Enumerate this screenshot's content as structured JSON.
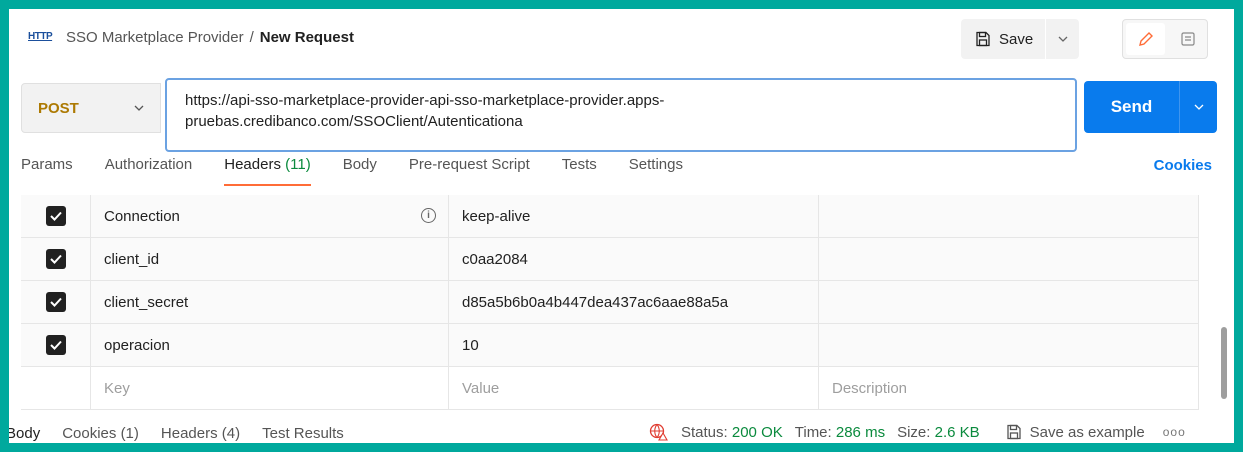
{
  "header": {
    "icon_label": "HTTP",
    "breadcrumb_parent": "SSO Marketplace Provider",
    "separator": "/",
    "breadcrumb_current": "New Request",
    "save_label": "Save"
  },
  "request": {
    "method": "POST",
    "url_line1": "https://api-sso-marketplace-provider-api-sso-marketplace-provider.apps-",
    "url_line2": "pruebas.credibanco.com/SSOClient/Autenticationa",
    "send_label": "Send"
  },
  "tabs": [
    {
      "label": "Params"
    },
    {
      "label": "Authorization"
    },
    {
      "label": "Headers",
      "count": "(11)",
      "active": true
    },
    {
      "label": "Body"
    },
    {
      "label": "Pre-request Script"
    },
    {
      "label": "Tests"
    },
    {
      "label": "Settings"
    }
  ],
  "cookies_label": "Cookies",
  "headers_table": {
    "rows": [
      {
        "key": "Connection",
        "value": "keep-alive",
        "description": "",
        "checked": true
      },
      {
        "key": "client_id",
        "value": "c0aa2084",
        "description": "",
        "checked": true
      },
      {
        "key": "client_secret",
        "value": "d85a5b6b0a4b447dea437ac6aae88a5a",
        "description": "",
        "checked": true
      },
      {
        "key": "operacion",
        "value": "10",
        "description": "",
        "checked": true
      }
    ],
    "placeholder": {
      "key": "Key",
      "value": "Value",
      "description": "Description"
    }
  },
  "footer": {
    "tabs": [
      "Body",
      "Cookies (1)",
      "Headers (4)",
      "Test Results"
    ],
    "status_label": "Status:",
    "status_value": "200 OK",
    "time_label": "Time:",
    "time_value": "286 ms",
    "size_label": "Size:",
    "size_value": "2.6 KB",
    "save_example": "Save as example",
    "more": "ooo"
  },
  "colors": {
    "accent": "#097bed",
    "method": "#ad7a03",
    "active_tab": "#ff6c37",
    "success": "#0a8a3d",
    "frame": "#00a99d"
  }
}
